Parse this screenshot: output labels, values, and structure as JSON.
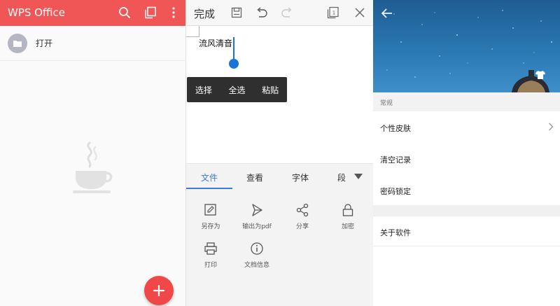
{
  "panel1": {
    "app_title": "WPS Office",
    "toolbar_icons": [
      "search-icon",
      "windows-icon",
      "more-vert-icon"
    ],
    "open_item_label": "打开",
    "open_item_icon": "folder-icon",
    "empty_state_icon": "coffee-cup-icon",
    "fab_icon": "plus-icon",
    "colors": {
      "appbar": "#f05656",
      "fab": "#f04848"
    }
  },
  "panel2": {
    "done_label": "完成",
    "toolbar_icons": [
      "save-icon",
      "undo-icon",
      "redo-icon",
      "window-count-icon",
      "close-icon"
    ],
    "window_count": "1",
    "document_text": "流风清音",
    "context_menu": [
      "选择",
      "全选",
      "粘贴"
    ],
    "tabs": [
      {
        "label": "文件",
        "active": true
      },
      {
        "label": "查看",
        "active": false
      },
      {
        "label": "字体",
        "active": false
      },
      {
        "label": "段",
        "active": false
      }
    ],
    "tab_more_icon": "triangle-down-icon",
    "tools": [
      {
        "label": "另存为",
        "icon": "save-as-icon"
      },
      {
        "label": "输出为pdf",
        "icon": "export-pdf-icon"
      },
      {
        "label": "分享",
        "icon": "share-icon"
      },
      {
        "label": "加密",
        "icon": "lock-icon"
      },
      {
        "label": "打印",
        "icon": "print-icon"
      },
      {
        "label": "文档信息",
        "icon": "info-icon"
      }
    ],
    "colors": {
      "accent": "#3a7ad9",
      "cursor": "#1a73d9"
    }
  },
  "panel3": {
    "back_icon": "back-arrow-icon",
    "header_badge_icon": "tshirt-icon",
    "section_title": "常规",
    "rows": [
      {
        "label": "个性皮肤",
        "has_chevron": true
      },
      {
        "label": "清空记录",
        "has_chevron": false
      },
      {
        "label": "密码锁定",
        "has_chevron": false
      }
    ],
    "about_label": "关于软件"
  }
}
